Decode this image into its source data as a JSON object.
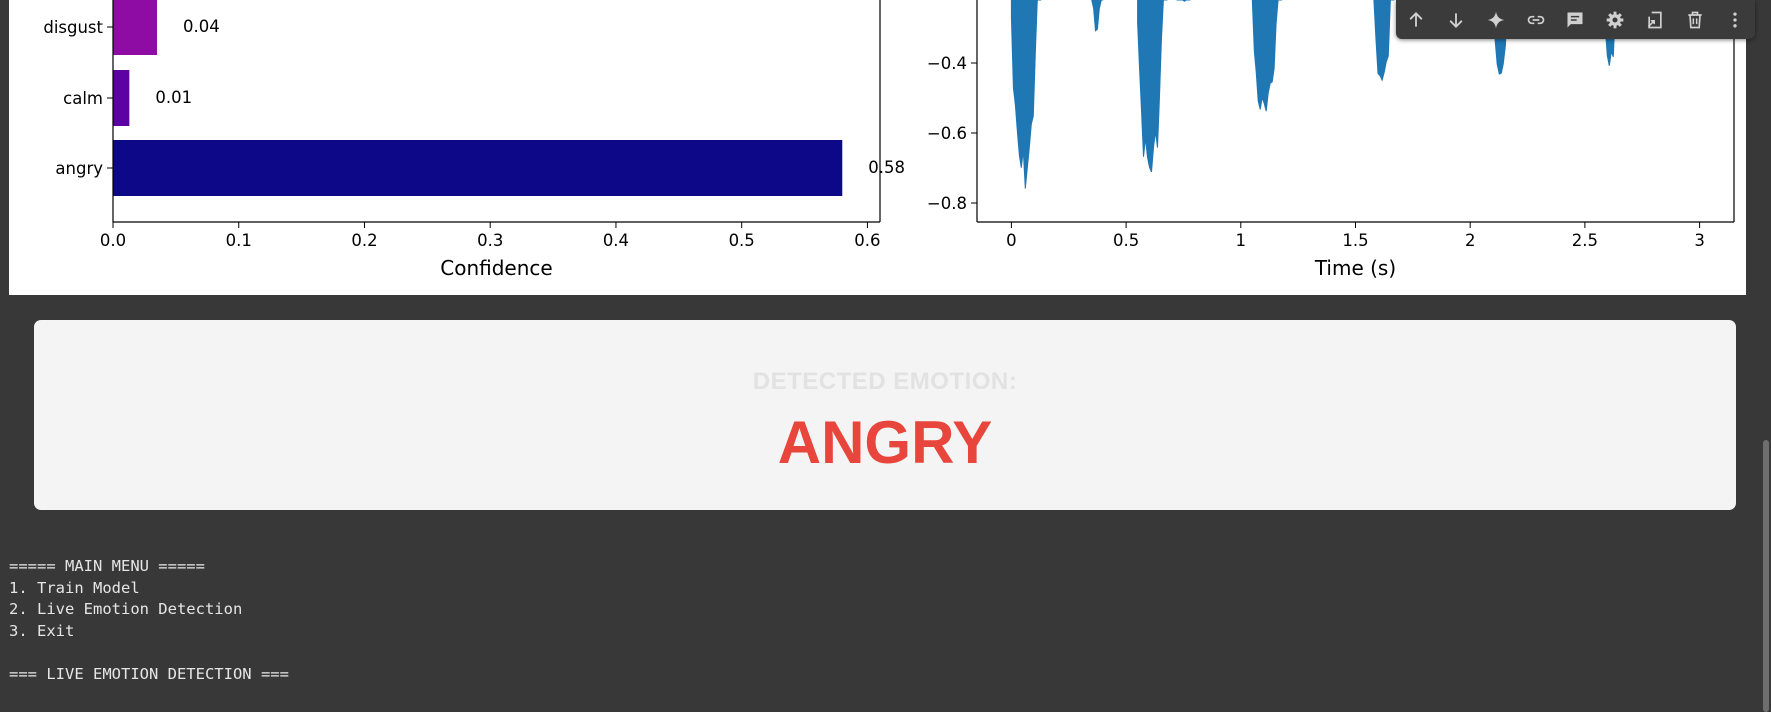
{
  "bar_chart": {
    "chart_data": {
      "type": "bar",
      "orientation": "horizontal",
      "categories": [
        "disgust",
        "calm",
        "angry"
      ],
      "values": [
        0.035,
        0.013,
        0.58
      ],
      "value_labels": [
        "0.04",
        "0.01",
        "0.58"
      ],
      "colors": [
        "#8e0ba4",
        "#5c02a3",
        "#0d0887"
      ],
      "xlabel": "Confidence",
      "xticks": [
        "0.0",
        "0.1",
        "0.2",
        "0.3",
        "0.4",
        "0.5",
        "0.6"
      ],
      "xlim": [
        0,
        0.61
      ]
    }
  },
  "waveform_chart": {
    "chart_data": {
      "type": "area",
      "xlabel": "Time (s)",
      "xticks": [
        "0",
        "0.5",
        "1",
        "1.5",
        "2",
        "2.5",
        "3"
      ],
      "yticks": [
        "−0.4",
        "−0.6",
        "−0.8"
      ],
      "xlim": [
        -0.15,
        3.15
      ],
      "color": "#1f77b4",
      "bursts": [
        {
          "start": 0.0,
          "end": 0.13,
          "min": -0.78
        },
        {
          "start": 0.35,
          "end": 0.4,
          "min": -0.34
        },
        {
          "start": 0.55,
          "end": 0.68,
          "min": -0.76
        },
        {
          "start": 0.72,
          "end": 0.78,
          "min": -0.24
        },
        {
          "start": 1.05,
          "end": 1.18,
          "min": -0.6
        },
        {
          "start": 1.58,
          "end": 1.67,
          "min": -0.5
        },
        {
          "start": 2.1,
          "end": 2.18,
          "min": -0.45
        },
        {
          "start": 2.58,
          "end": 2.65,
          "min": -0.43
        }
      ]
    }
  },
  "toolbar": {
    "items": [
      "move-up",
      "move-down",
      "gemini",
      "link",
      "comment",
      "settings",
      "mirror",
      "delete",
      "more"
    ]
  },
  "result": {
    "label": "DETECTED EMOTION:",
    "value": "ANGRY"
  },
  "console": {
    "lines": [
      "===== MAIN MENU =====",
      "1. Train Model",
      "2. Live Emotion Detection",
      "3. Exit",
      "",
      "=== LIVE EMOTION DETECTION ==="
    ]
  }
}
